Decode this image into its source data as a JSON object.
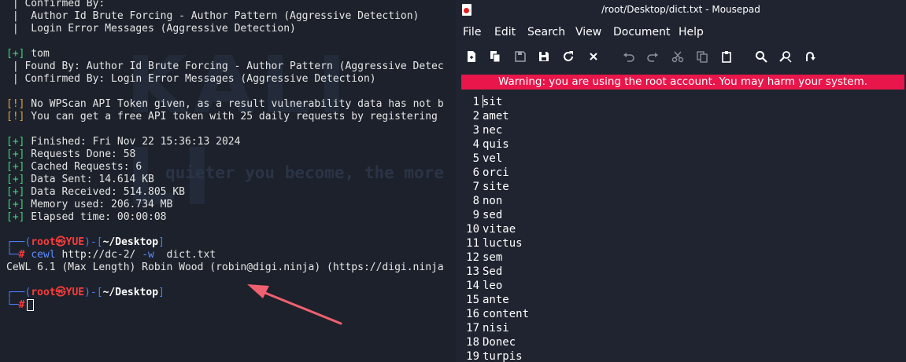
{
  "terminal": {
    "watermark": "KALI LI",
    "slogan": "quieter you become, the more",
    "lines": [
      " | Confirmed By:",
      " |  Author Id Brute Forcing - Author Pattern (Aggressive Detection)",
      " |  Login Error Messages (Aggressive Detection)",
      "",
      "[+] tom",
      " | Found By: Author Id Brute Forcing - Author Pattern (Aggressive Detec",
      " | Confirmed By: Login Error Messages (Aggressive Detection)",
      "",
      "[!] No WPScan API Token given, as a result vulnerability data has not b",
      "[!] You can get a free API token with 25 daily requests by registering",
      "",
      "[+] Finished: Fri Nov 22 15:36:13 2024",
      "[+] Requests Done: 58",
      "[+] Cached Requests: 6",
      "[+] Data Sent: 14.614 KB",
      "[+] Data Received: 514.805 KB",
      "[+] Memory used: 206.734 MB",
      "[+] Elapsed time: 00:00:08"
    ],
    "prompt_user": "root",
    "prompt_skull": "㉿",
    "prompt_host": "YUE",
    "prompt_dir": "~/Desktop",
    "prompt_hash": "#",
    "command_name": "cewl",
    "command_url": "http://dc-2/",
    "command_flag": "-w",
    "command_file": "dict.txt",
    "cewl_output": "CeWL 6.1 (Max Length) Robin Wood (robin@digi.ninja) (https://digi.ninja"
  },
  "mousepad": {
    "title": "/root/Desktop/dict.txt - Mousepad",
    "menu": [
      "File",
      "Edit",
      "Search",
      "View",
      "Document",
      "Help"
    ],
    "toolbar_icons": [
      "new-file-icon",
      "new-window-icon",
      "save-icon",
      "save-as-icon",
      "reload-icon",
      "close-icon",
      "undo-icon",
      "redo-icon",
      "cut-icon",
      "copy-icon",
      "paste-icon",
      "find-icon",
      "find-replace-icon",
      "goto-icon"
    ],
    "warning": "Warning: you are using the root account. You may harm your system.",
    "lines": [
      {
        "n": "1",
        "text": "sit"
      },
      {
        "n": "2",
        "text": "amet"
      },
      {
        "n": "3",
        "text": "nec"
      },
      {
        "n": "4",
        "text": "quis"
      },
      {
        "n": "5",
        "text": "vel"
      },
      {
        "n": "6",
        "text": "orci"
      },
      {
        "n": "7",
        "text": "site"
      },
      {
        "n": "8",
        "text": "non"
      },
      {
        "n": "9",
        "text": "sed"
      },
      {
        "n": "10",
        "text": "vitae"
      },
      {
        "n": "11",
        "text": "luctus"
      },
      {
        "n": "12",
        "text": "sem"
      },
      {
        "n": "13",
        "text": "Sed"
      },
      {
        "n": "14",
        "text": "leo"
      },
      {
        "n": "15",
        "text": "ante"
      },
      {
        "n": "16",
        "text": "content"
      },
      {
        "n": "17",
        "text": "nisi"
      },
      {
        "n": "18",
        "text": "Donec"
      },
      {
        "n": "19",
        "text": "turpis"
      }
    ]
  },
  "colors": {
    "warning_bg": "#e8164a",
    "arrow": "#f06070",
    "prompt_blue": "#4a7ef5",
    "prompt_red": "#ff3b3b"
  }
}
